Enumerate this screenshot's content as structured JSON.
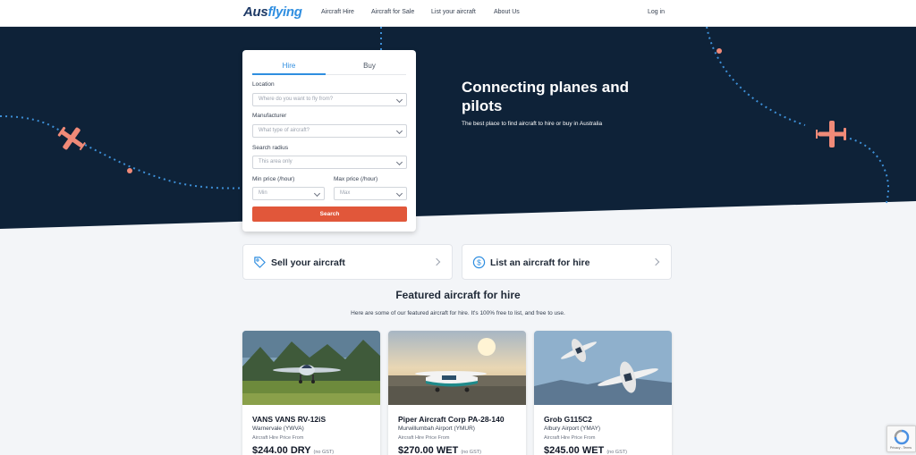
{
  "nav": {
    "logo_part1": "Aus",
    "logo_part2": "flying",
    "links": [
      "Aircraft Hire",
      "Aircraft for Sale",
      "List your aircraft",
      "About Us"
    ],
    "login": "Log in"
  },
  "hero": {
    "title": "Connecting planes and pilots",
    "subtitle": "The best place to find aircraft to hire or buy in Australia",
    "bg_color": "#0e2238",
    "accent_color": "#f08a78"
  },
  "search": {
    "tabs": [
      "Hire",
      "Buy"
    ],
    "active_tab": "Hire",
    "location_label": "Location",
    "location_placeholder": "Where do you want to fly from?",
    "manufacturer_label": "Manufacturer",
    "manufacturer_placeholder": "What type of aircraft?",
    "radius_label": "Search radius",
    "radius_placeholder": "This area only",
    "min_label": "Min price (/hour)",
    "min_placeholder": "Min",
    "max_label": "Max price (/hour)",
    "max_placeholder": "Max",
    "button": "Search",
    "button_color": "#e1573a"
  },
  "actions": [
    {
      "label": "Sell your aircraft",
      "icon": "tag-icon"
    },
    {
      "label": "List an aircraft for hire",
      "icon": "dollar-icon"
    }
  ],
  "featured": {
    "title": "Featured aircraft for hire",
    "subtitle": "Here are some of our featured aircraft for hire. It's 100% free to list, and free to use.",
    "cards": [
      {
        "name": "VANS VANS RV-12iS",
        "airport": "Warnervale (YWVA)",
        "from": "Aircraft Hire Price From",
        "price": "$244.00 DRY",
        "gst": "(no GST)"
      },
      {
        "name": "Piper Aircraft Corp PA-28-140",
        "airport": "Murwillumbah Airport (YMUR)",
        "from": "Aircraft Hire Price From",
        "price": "$270.00 WET",
        "gst": "(no GST)"
      },
      {
        "name": "Grob G115C2",
        "airport": "Albury Airport (YMAY)",
        "from": "Aircraft Hire Price From",
        "price": "$245.00 WET",
        "gst": "(no GST)"
      }
    ]
  },
  "recaptcha": {
    "text": "Privacy - Terms"
  }
}
